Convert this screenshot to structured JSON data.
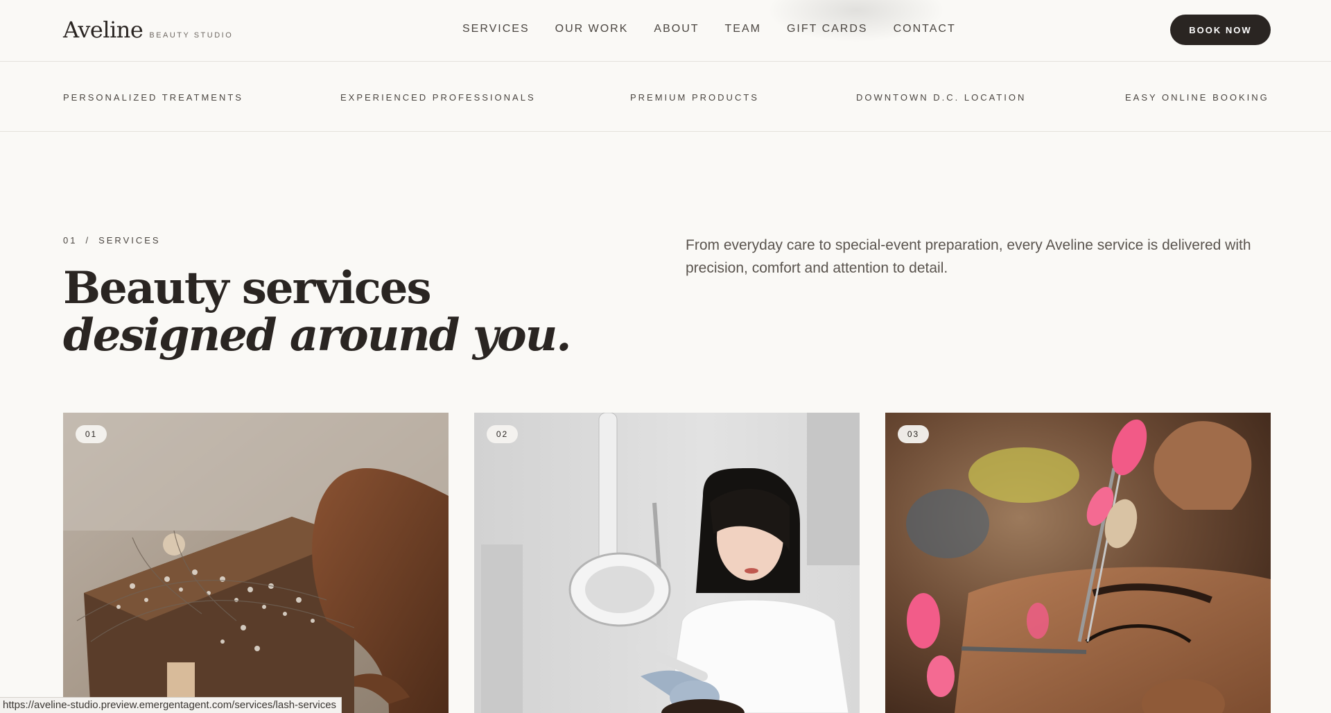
{
  "header": {
    "brand_name": "Aveline",
    "brand_sub": "BEAUTY STUDIO",
    "nav": [
      "SERVICES",
      "OUR WORK",
      "ABOUT",
      "TEAM",
      "GIFT CARDS",
      "CONTACT"
    ],
    "book_label": "BOOK NOW"
  },
  "features": [
    "PERSONALIZED TREATMENTS",
    "EXPERIENCED PROFESSIONALS",
    "PREMIUM PRODUCTS",
    "DOWNTOWN D.C. LOCATION",
    "EASY ONLINE BOOKING"
  ],
  "section": {
    "number": "01",
    "divider": "/",
    "label": "SERVICES",
    "headline_line1": "Beauty services",
    "headline_line2": "designed around you.",
    "intro": "From everyday care to special-event preparation, every Aveline service is delivered with precision, comfort and attention to detail."
  },
  "cards": [
    {
      "number": "01"
    },
    {
      "number": "02"
    },
    {
      "number": "03"
    }
  ],
  "status_url": "https://aveline-studio.preview.emergentagent.com/services/lash-services",
  "colors": {
    "background": "#faf9f6",
    "ink": "#2a2522",
    "button": "#2a2522",
    "rule": "#e4e1dc"
  }
}
